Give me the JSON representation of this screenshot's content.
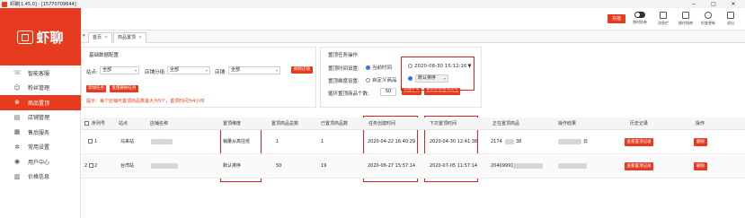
{
  "window": {
    "title": "虾聊[1.45.0] - [15770709644]",
    "controls": [
      "−",
      "□",
      "✕"
    ]
  },
  "sidebar": {
    "logo_text": "虾聊",
    "items": [
      {
        "label": "智能客服",
        "icon": "headset-icon",
        "glyph": "☏",
        "active": false
      },
      {
        "label": "粉丝管理",
        "icon": "fans-icon",
        "glyph": "☺",
        "active": false
      },
      {
        "label": "商品置顶",
        "icon": "pin-icon",
        "glyph": "⊗",
        "active": true
      },
      {
        "label": "店铺管理",
        "icon": "store-icon",
        "glyph": "▤",
        "active": false
      },
      {
        "label": "售后服务",
        "icon": "after-sales-icon",
        "glyph": "▦",
        "active": false
      },
      {
        "label": "常用设置",
        "icon": "settings-icon",
        "glyph": "✲",
        "active": false
      },
      {
        "label": "用户中心",
        "icon": "user-icon",
        "glyph": "◉",
        "active": false
      },
      {
        "label": "价格信息",
        "icon": "price-icon",
        "glyph": "▥",
        "active": false
      }
    ]
  },
  "toolbar": {
    "recharge": "充值",
    "tools": [
      {
        "label": "隐时防卷",
        "icon": "toggle-icon"
      },
      {
        "label": "消息栏",
        "icon": "message-icon"
      },
      {
        "label": "操作指南",
        "icon": "guide-icon"
      },
      {
        "label": "检查更新",
        "icon": "refresh-icon"
      },
      {
        "label": "退出",
        "icon": "exit-icon"
      }
    ],
    "accent": "#e63b1f"
  },
  "tabs": [
    {
      "label": "首页"
    },
    {
      "label": "商品置顶"
    }
  ],
  "config_panel": {
    "title": "基础数据配置",
    "site_label": "站点:",
    "site_value": "全部",
    "shop_group_label": "店铺分组:",
    "shop_group_value": "全部",
    "shop_label": "店铺:",
    "shop_value": "全部",
    "refresh_shop": "刷新店铺",
    "add_task": "添加任务",
    "batch_delete": "批量删除任务",
    "hint": "提示：每个店铺可置顶商品数最大为5个，置顶时间为4小时"
  },
  "task_panel": {
    "title": "置顶任务操作",
    "time_label": "置顶时间设置:",
    "time_opt_current": "当前时间",
    "time_opt_custom_value": "2020-08-30 15:12:16",
    "dim_label": "置顶维度设置:",
    "dim_opt_custom": "自定义商品",
    "dim_select_value": "默认排序",
    "loop_label": "循环置顶商品个数:",
    "loop_value": "50",
    "create_task": "创建任务",
    "reload_items": "重新获取置顶商品"
  },
  "table": {
    "columns": [
      "序列号",
      "站点",
      "店铺名称",
      "置顶维度",
      "置顶商品总数",
      "已置顶商品数",
      "任务创建时间",
      "下次置顶时间",
      "正在置顶商品",
      "操作结果",
      "历史记录",
      "操作"
    ],
    "rows": [
      {
        "index": "1",
        "site": "马来站",
        "dimension": "销量从高往低",
        "total": "1",
        "done": "1",
        "created": "2020-04-22 16:40:29",
        "next": "2020-04-30 12:41:38",
        "current_item": "2174",
        "current_item_tail": "38",
        "result_tail": "云",
        "history_btn": "查看置顶记录",
        "delete_btn": "删除"
      },
      {
        "index": "2",
        "site": "台湾站",
        "dimension": "默认排序",
        "total": "50",
        "done": "19",
        "created": "2020-06-27 15:57:14",
        "next": "2020-07-05 11:57:14",
        "current_item": "20409991",
        "current_item_tail": "",
        "result_tail": "",
        "history_btn": "查看置顶记录",
        "delete_btn": "删除"
      }
    ]
  }
}
